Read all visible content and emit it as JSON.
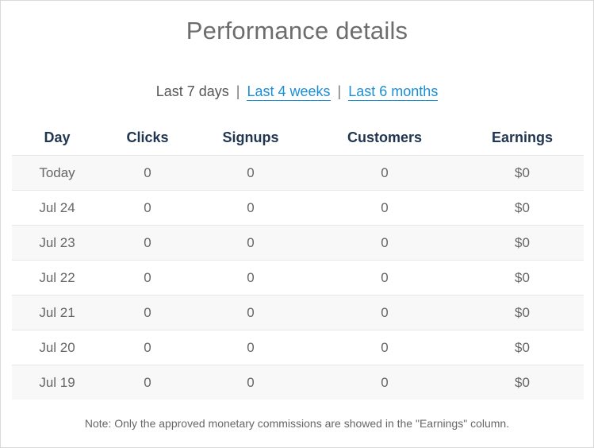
{
  "header": {
    "title": "Performance details"
  },
  "range_selector": {
    "current": "Last 7 days",
    "separator": "|",
    "link_4_weeks": "Last 4 weeks",
    "link_6_months": "Last 6 months"
  },
  "table": {
    "columns": [
      "Day",
      "Clicks",
      "Signups",
      "Customers",
      "Earnings"
    ],
    "rows": [
      [
        "Today",
        "0",
        "0",
        "0",
        "$0"
      ],
      [
        "Jul 24",
        "0",
        "0",
        "0",
        "$0"
      ],
      [
        "Jul 23",
        "0",
        "0",
        "0",
        "$0"
      ],
      [
        "Jul 22",
        "0",
        "0",
        "0",
        "$0"
      ],
      [
        "Jul 21",
        "0",
        "0",
        "0",
        "$0"
      ],
      [
        "Jul 20",
        "0",
        "0",
        "0",
        "$0"
      ],
      [
        "Jul 19",
        "0",
        "0",
        "0",
        "$0"
      ]
    ]
  },
  "footer": {
    "note": "Note: Only the approved monetary commissions are showed in the \"Earnings\" column."
  },
  "colors": {
    "link": "#1a8fd6",
    "header_text": "#1f3550",
    "stripe": "#f8f8f8"
  }
}
